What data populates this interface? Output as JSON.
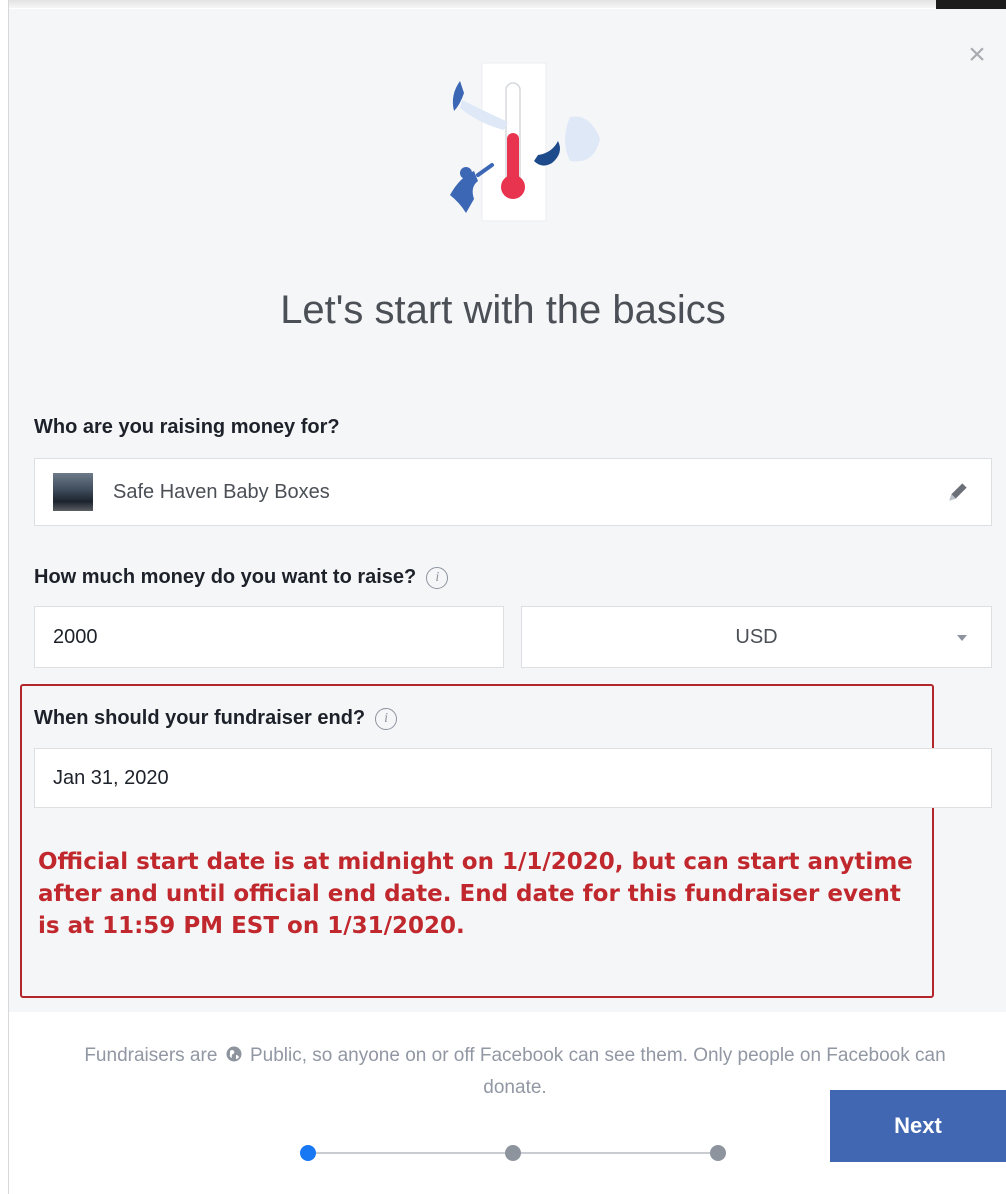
{
  "dialog": {
    "close_icon": "×",
    "title": "Let's start with the basics"
  },
  "beneficiary": {
    "label": "Who are you raising money for?",
    "value": "Safe Haven Baby Boxes"
  },
  "goal": {
    "label": "How much money do you want to raise?",
    "amount": "2000",
    "currency": "USD"
  },
  "end_date": {
    "label": "When should your fundraiser end?",
    "value": "Jan 31, 2020"
  },
  "annotation": {
    "text": "Official start date is at midnight on 1/1/2020, but can start anytime after and until official end date. End date for this fundraiser event is at 11:59 PM EST on 1/31/2020."
  },
  "footer": {
    "note_before": "Fundraisers are",
    "note_after": "Public, so anyone on or off Facebook can see them. Only people on Facebook can donate.",
    "next_label": "Next",
    "steps_total": 3,
    "current_step": 1
  },
  "colors": {
    "primary_button": "#4267b2",
    "active_step": "#1877f2",
    "annotation_red": "#c0282d",
    "thermometer_red": "#e8344e"
  },
  "icons": [
    "close-icon",
    "info-icon",
    "pencil-icon",
    "caret-down-icon",
    "globe-icon",
    "thermometer-illustration"
  ]
}
